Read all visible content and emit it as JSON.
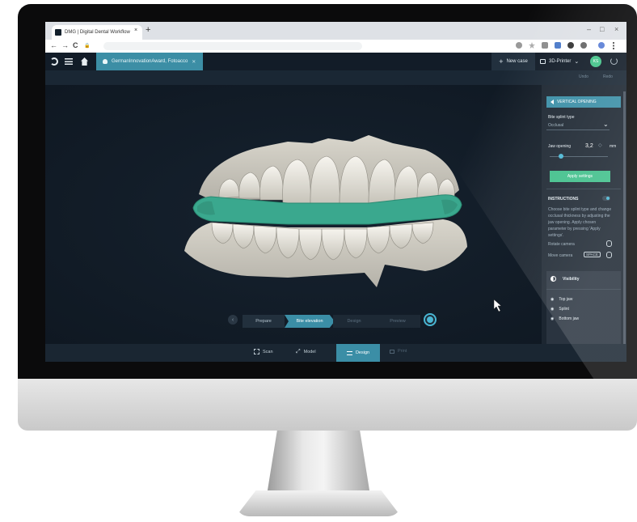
{
  "browser": {
    "tab_title": "DMG | Digital Dental Workflow",
    "tab_close": "×",
    "new_tab": "+",
    "window_controls": [
      "–",
      "□",
      "×"
    ],
    "nav": {
      "back": "←",
      "forward": "→",
      "reload": "C",
      "lock": "🔒"
    }
  },
  "app": {
    "case_tab": "GermanInnovationAward, Fotoacco",
    "case_tab_close": "✕",
    "new_case": "New case",
    "printer": "3D-Printer",
    "avatar": "KS",
    "undo": "Undo",
    "redo": "Redo"
  },
  "panel": {
    "header": "VERTICAL OPENING",
    "bite_splint_label": "Bite splint type",
    "bite_splint_value": "Occlusal",
    "jaw_opening_label": "Jaw opening",
    "jaw_opening_value": "3,2",
    "jaw_opening_unit": "mm",
    "apply_button": "Apply settings",
    "instructions_title": "INSTRUCTIONS",
    "instructions_text": "Choose bite splint type and change occlusal thickness by adjusting the jaw opening. Apply chosen parameter by pressing 'Apply settings'.",
    "rotate_camera": "Rotate camera",
    "move_camera": "Move camera",
    "space_key": "SPACE",
    "visibility_title": "Visibility",
    "visibility_items": [
      "Top jaw",
      "Splint",
      "Bottom jaw"
    ],
    "jaw_slider_fraction": 0.2
  },
  "workflow": {
    "steps": [
      "Prepare",
      "Bite elevation",
      "Design",
      "Preview"
    ],
    "active_step": 1
  },
  "bottom_tabs": [
    "Scan",
    "Model",
    "Design",
    "Print"
  ],
  "colors": {
    "accent": "#3b8ea6",
    "apply_green": "#3fbf8a",
    "splint": "#3aa88e",
    "teeth": "#e8e6de",
    "viewport_bg": "#111b26"
  }
}
